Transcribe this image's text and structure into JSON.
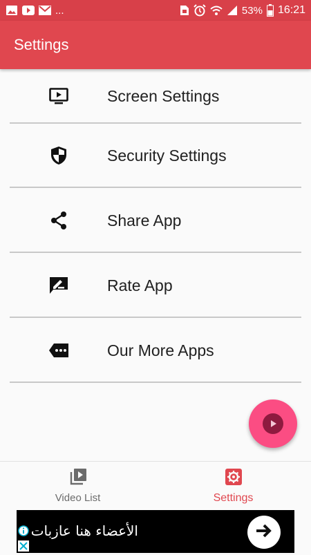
{
  "status_bar": {
    "ellipsis": "...",
    "battery": "53%",
    "time": "16:21",
    "icons": [
      "image-icon",
      "youtube-icon",
      "mail-icon",
      "sim-icon",
      "alarm-icon",
      "wifi-icon",
      "signal-icon",
      "battery-icon"
    ]
  },
  "app_bar": {
    "title": "Settings"
  },
  "settings_list": {
    "items": [
      {
        "label": "Screen Settings",
        "icon": "screen-icon"
      },
      {
        "label": "Security Settings",
        "icon": "shield-icon"
      },
      {
        "label": "Share App",
        "icon": "share-icon"
      },
      {
        "label": "Rate App",
        "icon": "rate-icon"
      },
      {
        "label": "Our More Apps",
        "icon": "more-apps-icon"
      }
    ]
  },
  "fab": {
    "icon": "play-icon"
  },
  "bottom_nav": {
    "items": [
      {
        "label": "Video List",
        "icon": "video-library-icon",
        "active": false
      },
      {
        "label": "Settings",
        "icon": "settings-icon",
        "active": true
      }
    ]
  },
  "ad": {
    "text": "الأعضاء هنا عازبات",
    "icons": [
      "info-icon",
      "close-icon",
      "arrow-right-icon"
    ]
  },
  "colors": {
    "status_bar": "#d84049",
    "app_bar": "#e0474f",
    "accent": "#e0474f",
    "fab": "#fb4d83"
  }
}
